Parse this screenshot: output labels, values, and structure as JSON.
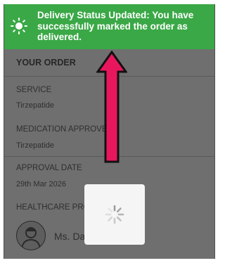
{
  "toast": {
    "icon": "sun-icon",
    "message": "Delivery Status Updated: You have successfully marked the order as delivered."
  },
  "order": {
    "heading": "YOUR ORDER",
    "service_label": "SERVICE",
    "service_value": "Tirzepatide",
    "medication_label": "MEDICATION APPROVE",
    "medication_value": "Tirzepatide",
    "approval_label": "APPROVAL DATE",
    "approval_value": "29th Mar 2026",
    "provider_label": "HEALTHCARE PRO",
    "provider_name": "Ms. Da"
  },
  "colors": {
    "toast_bg": "#3aa846",
    "overlay": "#6f6f6f",
    "arrow_fill": "#e8175d"
  },
  "loader": {
    "icon": "loading-spinner-icon"
  }
}
